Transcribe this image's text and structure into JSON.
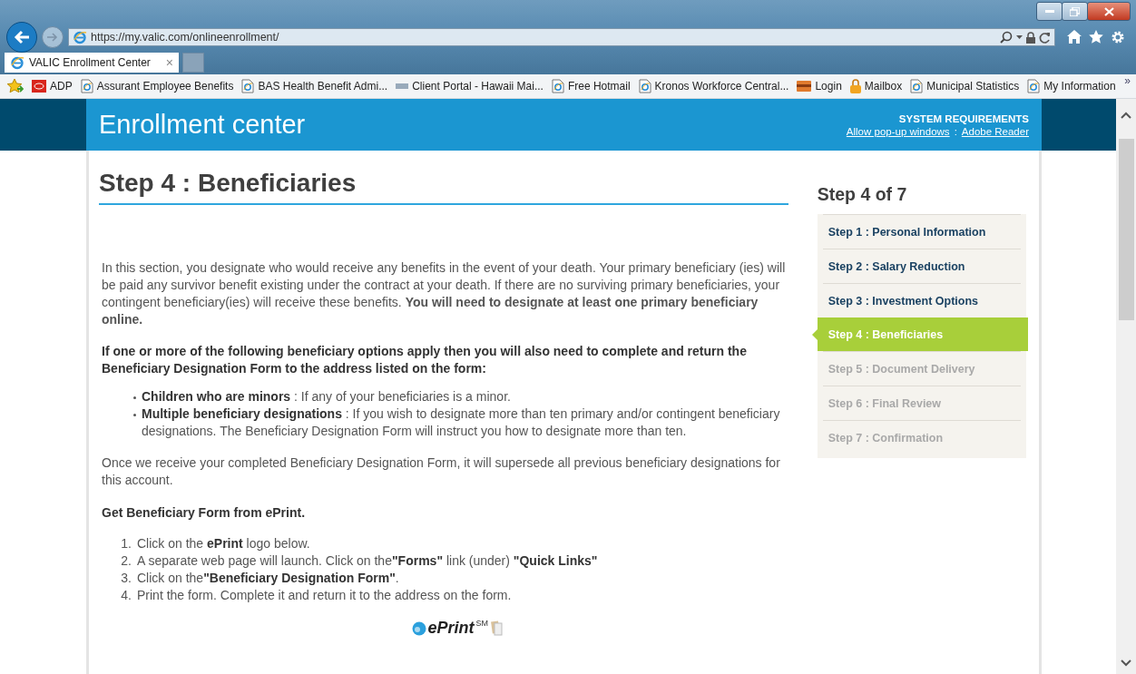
{
  "browser": {
    "url": "https://my.valic.com/onlineenrollment/",
    "tab": {
      "title": "VALIC Enrollment Center",
      "close": "×",
      "selected": true
    },
    "bookmarks": [
      {
        "kind": "adp",
        "label": "ADP"
      },
      {
        "kind": "page",
        "label": "Assurant Employee Benefits"
      },
      {
        "kind": "page",
        "label": "BAS Health  Benefit Admi..."
      },
      {
        "kind": "logo",
        "label": "Client Portal - Hawaii Mai..."
      },
      {
        "kind": "page",
        "label": "Free Hotmail"
      },
      {
        "kind": "page",
        "label": "Kronos Workforce Central..."
      },
      {
        "kind": "card",
        "label": "Login"
      },
      {
        "kind": "lock",
        "label": "Mailbox"
      },
      {
        "kind": "page",
        "label": "Municipal Statistics"
      },
      {
        "kind": "page",
        "label": "My Information"
      }
    ],
    "more": "»"
  },
  "header": {
    "title": "Enrollment center",
    "requirements": "SYSTEM REQUIREMENTS",
    "links": [
      "Allow pop-up windows",
      "Adobe Reader"
    ],
    "separator": ":"
  },
  "main": {
    "heading": "Step 4 : Beneficiaries",
    "intro": "In this section, you designate who would receive any benefits in the event of your death. Your primary beneficiary (ies) will be paid any survivor benefit existing under the contract at your death. If there are no surviving primary beneficiaries, your contingent beneficiary(ies) will receive these benefits. **You will need to designate at least one primary beneficiary online.**",
    "notice": "If one or more of the following beneficiary options apply then you will also need to complete and return the Beneficiary Designation Form to the address listed on the form:",
    "bullets": [
      "**Children who are minors** : If any of your beneficiaries is a minor.",
      "**Multiple beneficiary designations** : If you wish to designate more than ten primary and/or contingent beneficiary designations. The Beneficiary Designation Form will instruct you how to designate more than ten."
    ],
    "closing": "Once we receive your completed Beneficiary Designation Form, it will supersede all previous beneficiary designations for this account.",
    "subheading": "Get Beneficiary Form from ePrint.",
    "instructions": [
      {
        "number": "1.",
        "text": "Click on the **ePrint** logo below."
      },
      {
        "number": "2.",
        "text": "A separate web page will launch. Click on the**\"Forms\"** link (under) **\"Quick Links\"**"
      },
      {
        "number": "3.",
        "text": "Click on the**\"Beneficiary Designation Form\"**."
      },
      {
        "number": "4.",
        "text": "Print the form. Complete it and return it to the address on the form."
      }
    ],
    "logo": {
      "name": "ePrint",
      "mark": "SM"
    }
  },
  "progress": {
    "title": "Step 4 of 7",
    "steps": [
      {
        "label": "Step 1 : Personal Information",
        "selected": false,
        "disabled": false
      },
      {
        "label": "Step 2 : Salary Reduction",
        "selected": false,
        "disabled": false
      },
      {
        "label": "Step 3 : Investment Options",
        "selected": false,
        "disabled": false
      },
      {
        "label": "Step 4 : Beneficiaries",
        "selected": true,
        "disabled": false
      },
      {
        "label": "Step 5 : Document Delivery",
        "selected": false,
        "disabled": true
      },
      {
        "label": "Step 6 : Final Review",
        "selected": false,
        "disabled": true
      },
      {
        "label": "Step 7 : Confirmation",
        "selected": false,
        "disabled": true
      }
    ]
  }
}
